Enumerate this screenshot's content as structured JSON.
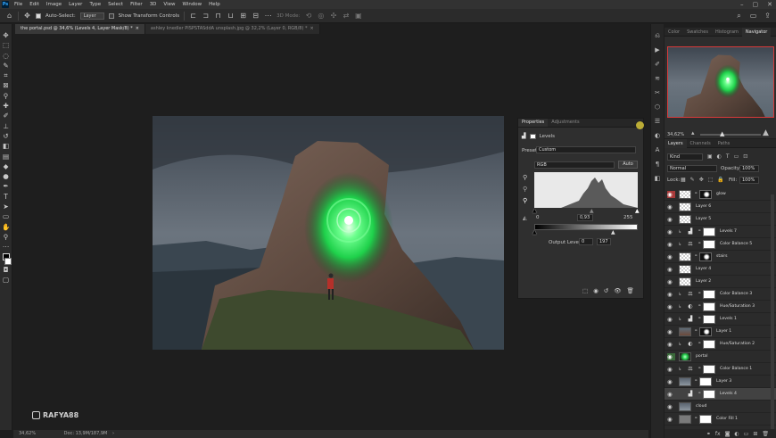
{
  "app": {
    "logo": "Ps"
  },
  "menu": [
    "File",
    "Edit",
    "Image",
    "Layer",
    "Type",
    "Select",
    "Filter",
    "3D",
    "View",
    "Window",
    "Help"
  ],
  "options": {
    "auto_select_label": "Auto-Select:",
    "auto_select_value": "Layer",
    "transform_label": "Show Transform Controls",
    "mode3d_label": "3D Mode:"
  },
  "tabs": [
    {
      "label": "the portal.psd @ 34,6% (Levels 4, Layer Mask/8) *",
      "close": "×"
    },
    {
      "label": "ashley knedler PISPSTASddA unsplash.jpg @ 32,2% (Layer 0, RGB/8) *",
      "close": "×"
    }
  ],
  "properties": {
    "tab_properties": "Properties",
    "tab_adjustments": "Adjustments",
    "title": "Levels",
    "preset_label": "Preset:",
    "preset_value": "Custom",
    "channel_value": "RGB",
    "auto_label": "Auto",
    "input_black": "0",
    "input_gamma": "0,93",
    "input_white": "255",
    "output_label": "Output Levels:",
    "output_black": "0",
    "output_white": "197"
  },
  "status": {
    "zoom": "34,62%",
    "doc": "Doc: 13,9M/187,9M"
  },
  "watermark": "RAFYA88",
  "navigator": {
    "tabs": [
      "Color",
      "Swatches",
      "Histogram",
      "Navigator"
    ],
    "zoom": "34,62%"
  },
  "layers_panel": {
    "tabs": [
      "Layers",
      "Channels",
      "Paths"
    ],
    "filter_kind": "Kind",
    "blend_mode": "Normal",
    "opacity_label": "Opacity:",
    "opacity_value": "100%",
    "lock_label": "Lock:",
    "fill_label": "Fill:",
    "fill_value": "100%",
    "layers": [
      {
        "name": "glow",
        "thumb": "checker",
        "mask": "dark",
        "eye": "red"
      },
      {
        "name": "Layer 6",
        "thumb": "checker"
      },
      {
        "name": "Layer 5",
        "thumb": "checker"
      },
      {
        "name": "Levels 7",
        "adj": "levels",
        "mask": "white",
        "clip": true
      },
      {
        "name": "Color Balance 5",
        "adj": "balance",
        "mask": "white",
        "clip": true
      },
      {
        "name": "stairs",
        "thumb": "checker",
        "mask": "dark"
      },
      {
        "name": "Layer 4",
        "thumb": "checker",
        "clip": true
      },
      {
        "name": "Layer 2",
        "thumb": "checker",
        "clip": true
      },
      {
        "name": "Color Balance 3",
        "adj": "balance",
        "mask": "white",
        "clip": true
      },
      {
        "name": "Hue/Saturation 3",
        "adj": "huesat",
        "mask": "white",
        "clip": true
      },
      {
        "name": "Levels 1",
        "adj": "levels",
        "mask": "white",
        "clip": true
      },
      {
        "name": "Layer 1",
        "thumb": "photo",
        "mask": "dark"
      },
      {
        "name": "Hue/Saturation 2",
        "adj": "huesat",
        "mask": "white",
        "clip": true
      },
      {
        "name": "portal",
        "thumb": "portal",
        "eye": "green"
      },
      {
        "name": "Color Balance 1",
        "adj": "balance",
        "mask": "white",
        "clip": true
      },
      {
        "name": "Layer 3",
        "thumb": "sky",
        "mask": "white"
      },
      {
        "name": "Levels 4",
        "adj": "levels",
        "mask": "white",
        "selected": true
      },
      {
        "name": "cloud",
        "thumb": "sky"
      },
      {
        "name": "Color Fill 1",
        "thumb": "gray",
        "mask": "white"
      }
    ]
  },
  "colors": {
    "glow": "#38e86a",
    "ui_bg": "#1e1e1e",
    "panel": "#2b2b2b",
    "nav_frame": "#d83a3a"
  }
}
